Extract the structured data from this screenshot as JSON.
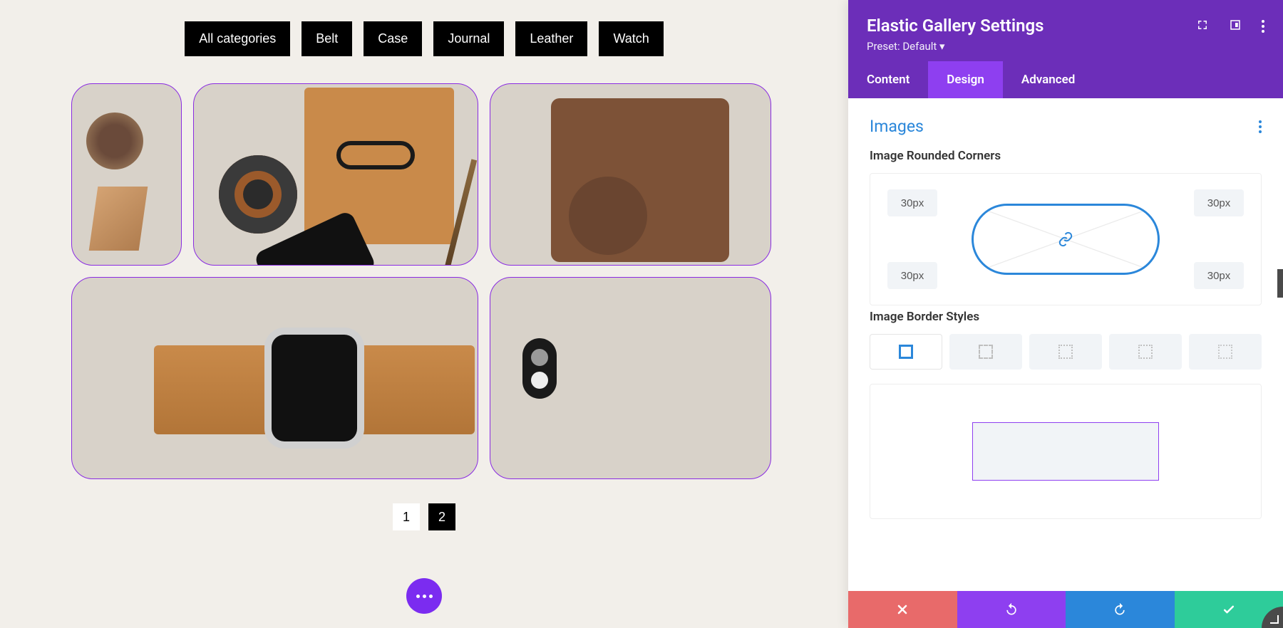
{
  "categories": [
    "All categories",
    "Belt",
    "Case",
    "Journal",
    "Leather",
    "Watch"
  ],
  "pagination": {
    "pages": [
      "1",
      "2"
    ],
    "active_index": 1
  },
  "panel": {
    "title": "Elastic Gallery Settings",
    "preset_label": "Preset: Default",
    "tabs": [
      "Content",
      "Design",
      "Advanced"
    ],
    "active_tab_index": 1,
    "section_title": "Images",
    "rounded_label": "Image Rounded Corners",
    "corners": {
      "tl": "30px",
      "tr": "30px",
      "bl": "30px",
      "br": "30px"
    },
    "border_label": "Image Border Styles",
    "border_styles": [
      "solid",
      "dashed",
      "dotted-square",
      "dotted-a",
      "dotted-b"
    ],
    "active_border_index": 0
  }
}
